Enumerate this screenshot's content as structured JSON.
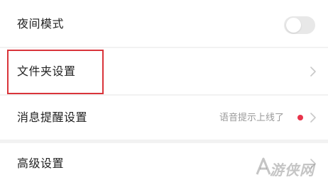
{
  "settings": {
    "night_mode": {
      "label": "夜间模式",
      "enabled": false
    },
    "folder_settings": {
      "label": "文件夹设置"
    },
    "notification_settings": {
      "label": "消息提醒设置",
      "hint": "语音提示上线了",
      "badge_color": "#e8344b"
    },
    "advanced_settings": {
      "label": "高级设置"
    }
  },
  "highlight_color": "#d9343a",
  "watermark": {
    "text": "游侠网"
  }
}
